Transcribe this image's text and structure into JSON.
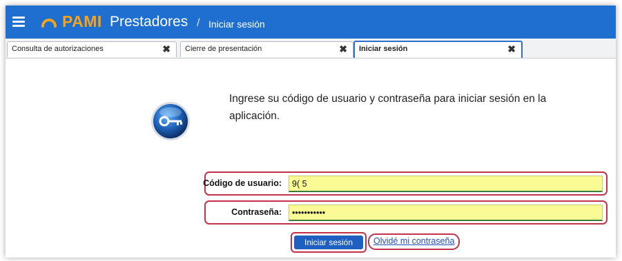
{
  "header": {
    "brand": "PAMI",
    "app_title": "Prestadores",
    "separator": "/",
    "breadcrumb": "Iniciar sesión",
    "menu_icon": "hamburger-menu-icon",
    "colors": {
      "bar": "#1f6fd1",
      "brand": "#f7a21b"
    }
  },
  "tabs": [
    {
      "label": "Consulta de autorizaciones",
      "close": "✖",
      "active": false
    },
    {
      "label": "Cierre de presentación",
      "close": "✖",
      "active": false
    },
    {
      "label": "Iniciar sesión",
      "close": "✖",
      "active": true
    }
  ],
  "login": {
    "intro": "Ingrese su código de usuario y contraseña para iniciar sesión en la aplicación.",
    "user_label": "Código de usuario:",
    "user_value": "9(          5",
    "password_label": "Contraseña:",
    "password_value": "•••••••••••",
    "submit_label": "Iniciar sesión",
    "forgot_label": "Olvidé mi contraseña",
    "icon": "key-icon",
    "colors": {
      "highlight": "#c0324a",
      "input_bg": "#fbfb95",
      "button": "#1f5fbf"
    }
  }
}
